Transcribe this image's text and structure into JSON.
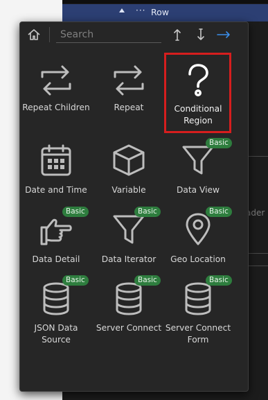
{
  "background": {
    "row_label": "Row",
    "row_dots": "···",
    "faded_text": "ader"
  },
  "toolbar": {
    "search_placeholder": "Search"
  },
  "badge_label": "Basic",
  "items": [
    {
      "label": "Repeat Children",
      "icon": "repeat-children-icon"
    },
    {
      "label": "Repeat",
      "icon": "repeat-icon"
    },
    {
      "label": "Conditional Region",
      "icon": "question-mark-icon",
      "selected": true
    },
    {
      "label": "Date and Time",
      "icon": "calendar-icon"
    },
    {
      "label": "Variable",
      "icon": "cube-icon"
    },
    {
      "label": "Data View",
      "icon": "filter-icon",
      "badge": true
    },
    {
      "label": "Data Detail",
      "icon": "pointing-hand-icon",
      "badge": true
    },
    {
      "label": "Data Iterator",
      "icon": "filter-icon",
      "badge": true
    },
    {
      "label": "Geo Location",
      "icon": "map-pin-icon",
      "badge": true
    },
    {
      "label": "JSON Data Source",
      "icon": "database-icon",
      "badge": true
    },
    {
      "label": "Server Connect",
      "icon": "database-icon",
      "badge": true
    },
    {
      "label": "Server Connect Form",
      "icon": "database-icon",
      "badge": true
    }
  ],
  "colors": {
    "selection": "#d61e1e",
    "badge": "#2e7d3e",
    "accent_arrow": "#3b8eea",
    "row_highlight": "#2c3f73"
  }
}
